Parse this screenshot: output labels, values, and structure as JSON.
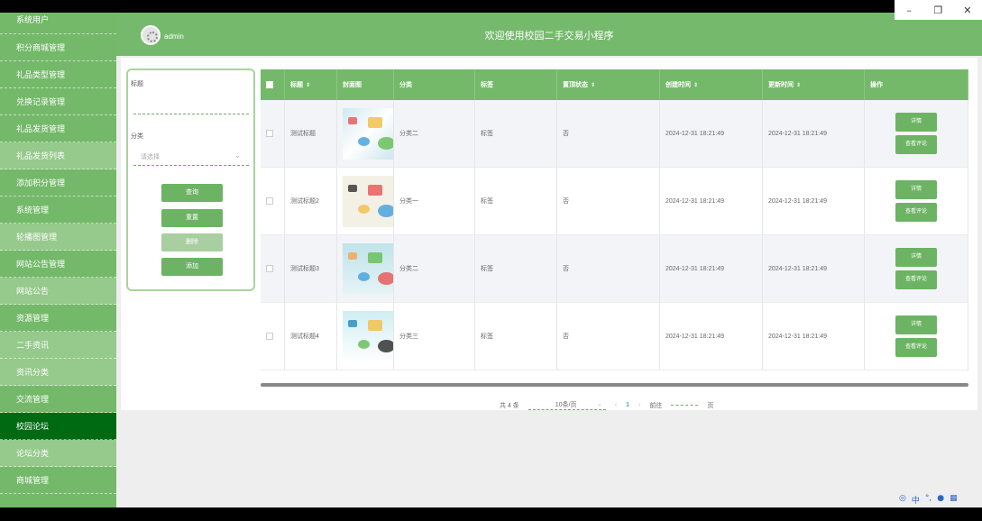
{
  "window": {
    "minimize": "–",
    "restore": "❐",
    "close": "✕"
  },
  "sidebar": {
    "items": [
      {
        "label": "系统用户",
        "variant": "first"
      },
      {
        "label": "积分商城管理",
        "variant": ""
      },
      {
        "label": "礼品类型管理",
        "variant": ""
      },
      {
        "label": "兑换记录管理",
        "variant": ""
      },
      {
        "label": "礼品发货管理",
        "variant": ""
      },
      {
        "label": "礼品发货列表",
        "variant": "sub"
      },
      {
        "label": "添加积分管理",
        "variant": ""
      },
      {
        "label": "系统管理",
        "variant": ""
      },
      {
        "label": "轮播图管理",
        "variant": "sub"
      },
      {
        "label": "网站公告管理",
        "variant": ""
      },
      {
        "label": "网站公告",
        "variant": "sub"
      },
      {
        "label": "资源管理",
        "variant": ""
      },
      {
        "label": "二手资讯",
        "variant": "sub"
      },
      {
        "label": "资讯分类",
        "variant": "sub"
      },
      {
        "label": "交流管理",
        "variant": ""
      },
      {
        "label": "校园论坛",
        "variant": "active"
      },
      {
        "label": "论坛分类",
        "variant": "sub"
      },
      {
        "label": "商城管理",
        "variant": ""
      }
    ]
  },
  "header": {
    "username": "admin",
    "title": "欢迎使用校园二手交易小程序"
  },
  "search": {
    "title_label": "标题",
    "category_label": "分类",
    "category_placeholder": "请选择",
    "query_button": "查询",
    "reset_button": "重置",
    "delete_button": "删除",
    "add_button": "添加"
  },
  "table": {
    "headers": {
      "title": "标题",
      "cover": "封面图",
      "category": "分类",
      "tag": "标签",
      "pinned": "置顶状态",
      "created": "创建时间",
      "updated": "更新时间",
      "actions": "操作"
    },
    "rows": [
      {
        "title": "测试标题",
        "category": "分类二",
        "tag": "标签",
        "pinned": "否",
        "created": "2024-12-31 18:21:49",
        "updated": "2024-12-31 18:21:49",
        "detail": "详情",
        "comments": "查看评论"
      },
      {
        "title": "测试标题2",
        "category": "分类一",
        "tag": "标签",
        "pinned": "否",
        "created": "2024-12-31 18:21:49",
        "updated": "2024-12-31 18:21:49",
        "detail": "详情",
        "comments": "查看评论"
      },
      {
        "title": "测试标题3",
        "category": "分类二",
        "tag": "标签",
        "pinned": "否",
        "created": "2024-12-31 18:21:49",
        "updated": "2024-12-31 18:21:49",
        "detail": "详情",
        "comments": "查看评论"
      },
      {
        "title": "测试标题4",
        "category": "分类三",
        "tag": "标签",
        "pinned": "否",
        "created": "2024-12-31 18:21:49",
        "updated": "2024-12-31 18:21:49",
        "detail": "详情",
        "comments": "查看评论"
      }
    ]
  },
  "pager": {
    "total": "共 4 条",
    "page_size": "10条/页",
    "current_page": "1",
    "goto_label": "前往",
    "page_unit": "页"
  },
  "tray": {
    "icons": [
      "ime-icon",
      "lang-icon",
      "punct-icon",
      "mic-icon",
      "grid-icon"
    ],
    "lang": "中"
  }
}
